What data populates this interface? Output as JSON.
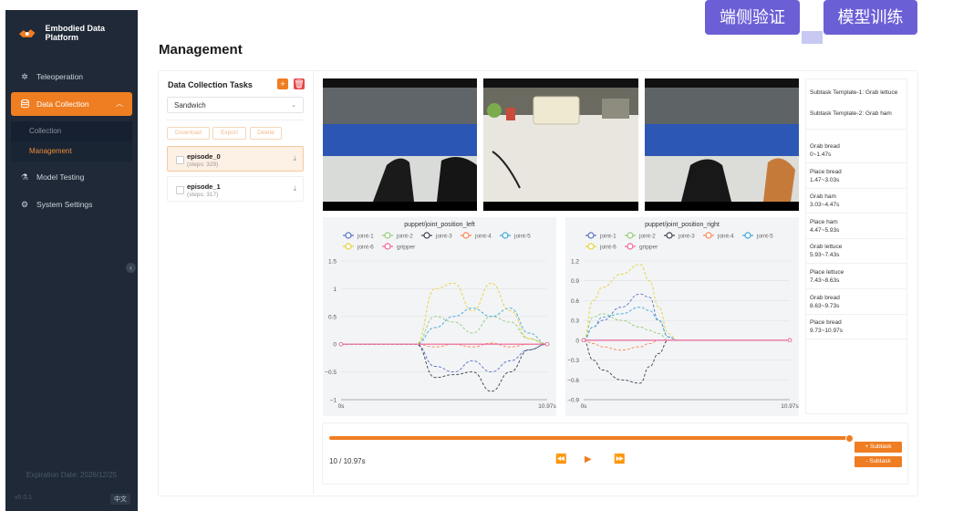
{
  "app": {
    "brand": "Embodied Data Platform"
  },
  "sidebar": {
    "items": [
      {
        "label": "Teleoperation",
        "icon": "teleoperation-icon"
      },
      {
        "label": "Data Collection",
        "icon": "database-icon"
      },
      {
        "label": "Model Testing",
        "icon": "flask-icon"
      },
      {
        "label": "System Settings",
        "icon": "gear-icon"
      }
    ],
    "sub_items": [
      {
        "label": "Collection"
      },
      {
        "label": "Management"
      }
    ],
    "expiration": "Expiration Date: 2026/12/25",
    "version": "v0.0.1",
    "lang": "中文"
  },
  "top_buttons": {
    "left": "端侧验证",
    "right": "模型训练"
  },
  "page": {
    "title": "Management"
  },
  "tasks": {
    "title": "Data Collection Tasks",
    "select_value": "Sandwich",
    "buttons": {
      "download": "Download",
      "export": "Export",
      "delete": "Delete"
    },
    "episodes": [
      {
        "name": "episode_0",
        "steps": "(steps: 329)"
      },
      {
        "name": "episode_1",
        "steps": "(steps: 317)"
      }
    ]
  },
  "subtasks": {
    "templates": [
      "Subtask Template-1: Grab lettuce",
      "Subtask Template-2: Grab ham"
    ],
    "segments": [
      {
        "name": "Grab bread",
        "range": "0~1.47s"
      },
      {
        "name": "Place bread",
        "range": "1.47~3.03s"
      },
      {
        "name": "Grab ham",
        "range": "3.03~4.47s"
      },
      {
        "name": "Place ham",
        "range": "4.47~5.93s"
      },
      {
        "name": "Grab lettuce",
        "range": "5.93~7.43s"
      },
      {
        "name": "Place lettuce",
        "range": "7.43~8.63s"
      },
      {
        "name": "Grab bread",
        "range": "8.63~9.73s"
      },
      {
        "name": "Place bread",
        "range": "9.73~10.97s"
      }
    ]
  },
  "player": {
    "time": "10 / 10.97s",
    "progress": 1.0,
    "add_subtask": "+ Subtask",
    "remove_subtask": "- Subtask"
  },
  "colors": {
    "accent": "#ef7d22",
    "purple": "#6b5fd6",
    "sidebar": "#1f2937"
  },
  "chart_data": [
    {
      "type": "line",
      "title": "puppet/joint_position_left",
      "xlabel": "",
      "ylabel": "",
      "x_ticks": [
        "0s",
        "10.97s"
      ],
      "y_ticks": [
        "1.5",
        "1",
        "0.5",
        "0",
        "−0.5",
        "−1"
      ],
      "xlim": [
        0,
        10.97
      ],
      "ylim": [
        -1,
        1.5
      ],
      "x": [
        0,
        4.0,
        5.0,
        6.0,
        7.0,
        8.0,
        9.0,
        10.0,
        10.97
      ],
      "series": [
        {
          "name": "joint-1",
          "color": "#5470c6",
          "values": [
            0,
            0,
            -0.4,
            -0.5,
            -0.3,
            -0.5,
            -0.3,
            -0.1,
            0
          ]
        },
        {
          "name": "joint-2",
          "color": "#91cc75",
          "values": [
            0,
            0,
            0.5,
            0.4,
            0.2,
            0.5,
            0.4,
            0.1,
            0
          ]
        },
        {
          "name": "joint-3",
          "color": "#3b3f50",
          "values": [
            0,
            0,
            -0.6,
            -0.55,
            -0.5,
            -0.85,
            -0.5,
            -0.1,
            0
          ]
        },
        {
          "name": "joint-4",
          "color": "#fc8452",
          "values": [
            0,
            0,
            -0.05,
            0,
            -0.05,
            0.02,
            -0.05,
            0,
            0
          ]
        },
        {
          "name": "joint-5",
          "color": "#3aa7d9",
          "values": [
            0,
            0,
            0.3,
            0.5,
            0.65,
            0.5,
            0.65,
            0.2,
            0
          ]
        },
        {
          "name": "joint-6",
          "color": "#e6d234",
          "values": [
            0,
            0,
            1.0,
            1.1,
            0.6,
            1.1,
            0.6,
            0.1,
            0
          ]
        },
        {
          "name": "gripper",
          "color": "#ee6699",
          "values": [
            0,
            0,
            0,
            0,
            0,
            0,
            0,
            0,
            0
          ]
        }
      ]
    },
    {
      "type": "line",
      "title": "puppet/joint_position_right",
      "xlabel": "",
      "ylabel": "",
      "x_ticks": [
        "0s",
        "10.97s"
      ],
      "y_ticks": [
        "1.2",
        "0.9",
        "0.6",
        "0.3",
        "0",
        "−0.3",
        "−0.6",
        "−0.9"
      ],
      "xlim": [
        0,
        10.97
      ],
      "ylim": [
        -0.9,
        1.2
      ],
      "x": [
        0,
        0.5,
        1.0,
        2.0,
        3.0,
        3.5,
        4.0,
        4.5,
        5.0,
        10.97
      ],
      "series": [
        {
          "name": "joint-1",
          "color": "#5470c6",
          "values": [
            0,
            0.2,
            0.3,
            0.5,
            0.7,
            0.65,
            0.3,
            0.05,
            0,
            0
          ]
        },
        {
          "name": "joint-2",
          "color": "#91cc75",
          "values": [
            0,
            0.35,
            0.4,
            0.3,
            0.2,
            0.15,
            0.1,
            0,
            0,
            0
          ]
        },
        {
          "name": "joint-3",
          "color": "#3b3f50",
          "values": [
            0,
            -0.3,
            -0.45,
            -0.6,
            -0.65,
            -0.4,
            -0.2,
            0,
            0,
            0
          ]
        },
        {
          "name": "joint-4",
          "color": "#fc8452",
          "values": [
            0,
            -0.05,
            -0.1,
            -0.15,
            -0.1,
            -0.05,
            0,
            0,
            0,
            0
          ]
        },
        {
          "name": "joint-5",
          "color": "#3aa7d9",
          "values": [
            0,
            0.2,
            0.35,
            0.4,
            0.5,
            0.45,
            0.3,
            0.05,
            0,
            0
          ]
        },
        {
          "name": "joint-6",
          "color": "#e6d234",
          "values": [
            0,
            0.6,
            0.8,
            1.0,
            1.15,
            0.9,
            0.5,
            0.1,
            0,
            0
          ]
        },
        {
          "name": "gripper",
          "color": "#ee6699",
          "values": [
            0,
            0,
            0,
            0,
            0,
            0,
            0,
            0,
            0,
            0
          ]
        }
      ]
    }
  ]
}
